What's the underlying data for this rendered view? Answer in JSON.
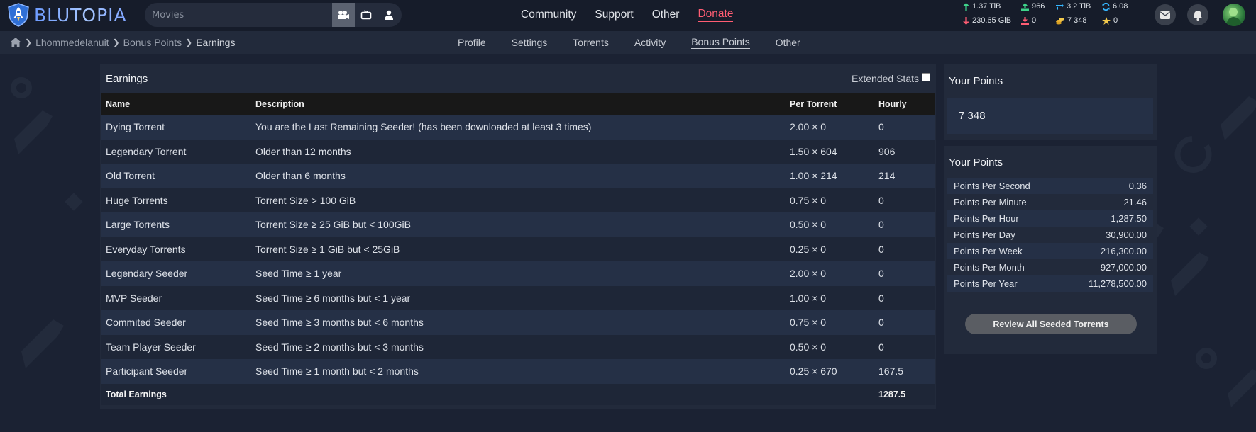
{
  "brand": {
    "name": "BLUTOPIA"
  },
  "search": {
    "placeholder": "Movies"
  },
  "nav": {
    "community": "Community",
    "support": "Support",
    "other": "Other",
    "donate": "Donate"
  },
  "stats": {
    "upload": "1.37 TiB",
    "download": "230.65 GiB",
    "seeding": "966",
    "leeching": "0",
    "buffer": "3.2 TiB",
    "bonus": "7 348",
    "ratio": "6.08",
    "fl_tokens": "0"
  },
  "breadcrumb": {
    "user": "Lhommedelanuit",
    "section": "Bonus Points",
    "page": "Earnings"
  },
  "subnav": {
    "profile": "Profile",
    "settings": "Settings",
    "torrents": "Torrents",
    "activity": "Activity",
    "bonus": "Bonus Points",
    "other": "Other"
  },
  "earnings": {
    "title": "Earnings",
    "extended_stats": "Extended Stats",
    "headers": {
      "name": "Name",
      "description": "Description",
      "per_torrent": "Per Torrent",
      "hourly": "Hourly"
    },
    "rows": [
      {
        "name": "Dying Torrent",
        "description": "You are the Last Remaining Seeder! (has been downloaded at least 3 times)",
        "per_torrent": "2.00 × 0",
        "hourly": "0"
      },
      {
        "name": "Legendary Torrent",
        "description": "Older than 12 months",
        "per_torrent": "1.50 × 604",
        "hourly": "906"
      },
      {
        "name": "Old Torrent",
        "description": "Older than 6 months",
        "per_torrent": "1.00 × 214",
        "hourly": "214"
      },
      {
        "name": "Huge Torrents",
        "description": "Torrent Size > 100 GiB",
        "per_torrent": "0.75 × 0",
        "hourly": "0"
      },
      {
        "name": "Large Torrents",
        "description": "Torrent Size ≥ 25 GiB but < 100GiB",
        "per_torrent": "0.50 × 0",
        "hourly": "0"
      },
      {
        "name": "Everyday Torrents",
        "description": "Torrent Size ≥ 1 GiB but < 25GiB",
        "per_torrent": "0.25 × 0",
        "hourly": "0"
      },
      {
        "name": "Legendary Seeder",
        "description": "Seed Time ≥ 1 year",
        "per_torrent": "2.00 × 0",
        "hourly": "0"
      },
      {
        "name": "MVP Seeder",
        "description": "Seed Time ≥ 6 months but < 1 year",
        "per_torrent": "1.00 × 0",
        "hourly": "0"
      },
      {
        "name": "Commited Seeder",
        "description": "Seed Time ≥ 3 months but < 6 months",
        "per_torrent": "0.75 × 0",
        "hourly": "0"
      },
      {
        "name": "Team Player Seeder",
        "description": "Seed Time ≥ 2 months but < 3 months",
        "per_torrent": "0.50 × 0",
        "hourly": "0"
      },
      {
        "name": "Participant Seeder",
        "description": "Seed Time ≥ 1 month but < 2 months",
        "per_torrent": "0.25 × 670",
        "hourly": "167.5"
      }
    ],
    "total_label": "Total Earnings",
    "total_value": "1287.5"
  },
  "your_points": {
    "title": "Your Points",
    "value": "7 348"
  },
  "rates": {
    "title": "Your Points",
    "rows": [
      {
        "label": "Points Per Second",
        "value": "0.36"
      },
      {
        "label": "Points Per Minute",
        "value": "21.46"
      },
      {
        "label": "Points Per Hour",
        "value": "1,287.50"
      },
      {
        "label": "Points Per Day",
        "value": "30,900.00"
      },
      {
        "label": "Points Per Week",
        "value": "216,300.00"
      },
      {
        "label": "Points Per Month",
        "value": "927,000.00"
      },
      {
        "label": "Points Per Year",
        "value": "11,278,500.00"
      }
    ],
    "review_button": "Review All Seeded Torrents"
  },
  "colors": {
    "background": "#1b2233",
    "panel": "#222a3b",
    "topbar": "#161c2a",
    "accent": "#ff5d73",
    "row_alt": "#253046"
  }
}
